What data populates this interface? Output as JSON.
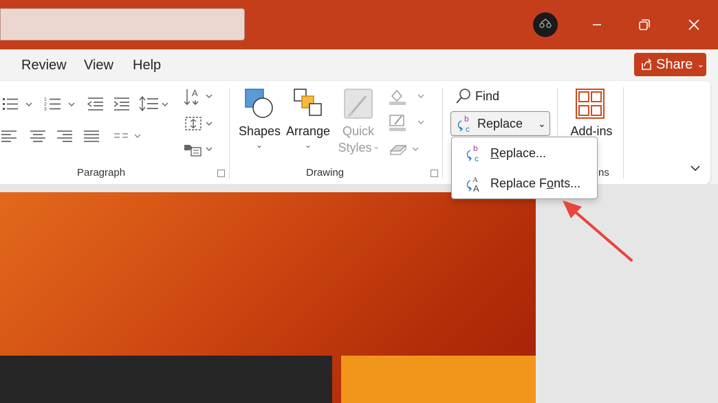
{
  "menu": {
    "items": [
      "Review",
      "View",
      "Help"
    ],
    "share_label": "Share"
  },
  "ribbon": {
    "paragraph": {
      "label": "Paragraph"
    },
    "drawing": {
      "label": "Drawing",
      "shapes": "Shapes",
      "arrange": "Arrange",
      "quick_styles_line1": "Quick",
      "quick_styles_line2": "Styles"
    },
    "editing": {
      "find": "Find",
      "replace": "Replace"
    },
    "addins": {
      "label": "Add-ins",
      "group_label_partial": "ns"
    }
  },
  "dropdown": {
    "items": [
      {
        "underline": "R",
        "rest": "eplace..."
      },
      {
        "before": "Replace F",
        "underline": "o",
        "rest": "nts..."
      }
    ]
  },
  "colors": {
    "accent": "#c43e1c",
    "annotation_arrow": "#e8453c"
  }
}
